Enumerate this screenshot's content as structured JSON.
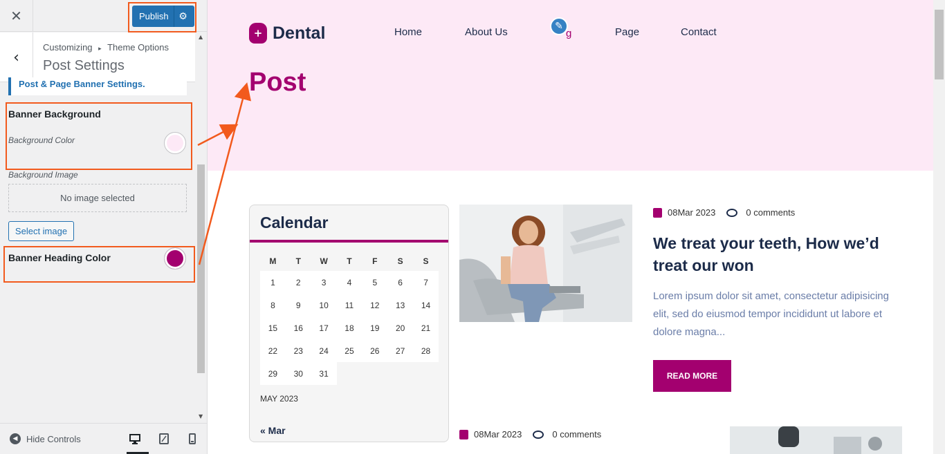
{
  "customizer": {
    "close_icon": "close-icon",
    "publish_label": "Publish",
    "gear_icon": "gear-icon",
    "breadcrumb_first": "Customizing",
    "breadcrumb_sep": "▸",
    "breadcrumb_second": "Theme Options",
    "section_title": "Post Settings",
    "banner_note": "Post & Page Banner Settings.",
    "banner_background_title": "Banner Background",
    "background_color_label": "Background Color",
    "background_color_value": "#fde9f6",
    "background_image_label": "Background Image",
    "no_image_text": "No image selected",
    "select_image_label": "Select image",
    "banner_heading_color_title": "Banner Heading Color",
    "banner_heading_color_value": "#a3006f",
    "hide_controls_label": "Hide Controls",
    "devices": [
      "desktop-icon",
      "tablet-icon",
      "mobile-icon"
    ]
  },
  "site": {
    "logo_text": "Dental",
    "nav": [
      "Home",
      "About Us",
      "g",
      "Page",
      "Contact"
    ],
    "page_title": "Post",
    "accent_color": "#a3006f",
    "dark_color": "#1c2b49",
    "banner_bg": "#fde9f6"
  },
  "calendar": {
    "heading": "Calendar",
    "weekdays": [
      "M",
      "T",
      "W",
      "T",
      "F",
      "S",
      "S"
    ],
    "weeks": [
      [
        "1",
        "2",
        "3",
        "4",
        "5",
        "6",
        "7"
      ],
      [
        "8",
        "9",
        "10",
        "11",
        "12",
        "13",
        "14"
      ],
      [
        "15",
        "16",
        "17",
        "18",
        "19",
        "20",
        "21"
      ],
      [
        "22",
        "23",
        "24",
        "25",
        "26",
        "27",
        "28"
      ],
      [
        "29",
        "30",
        "31",
        "",
        "",
        "",
        ""
      ]
    ],
    "month_label": "MAY 2023",
    "prev_link": "« Mar"
  },
  "posts": [
    {
      "date": "08Mar 2023",
      "comments": "0 comments",
      "title": "We treat your teeth, How we’d treat our won",
      "excerpt": "Lorem ipsum dolor sit amet, consectetur adipisicing elit, sed do eiusmod tempor incididunt ut labore et dolore magna...",
      "read_more": "READ MORE"
    },
    {
      "date": "08Mar 2023",
      "comments": "0 comments"
    }
  ]
}
